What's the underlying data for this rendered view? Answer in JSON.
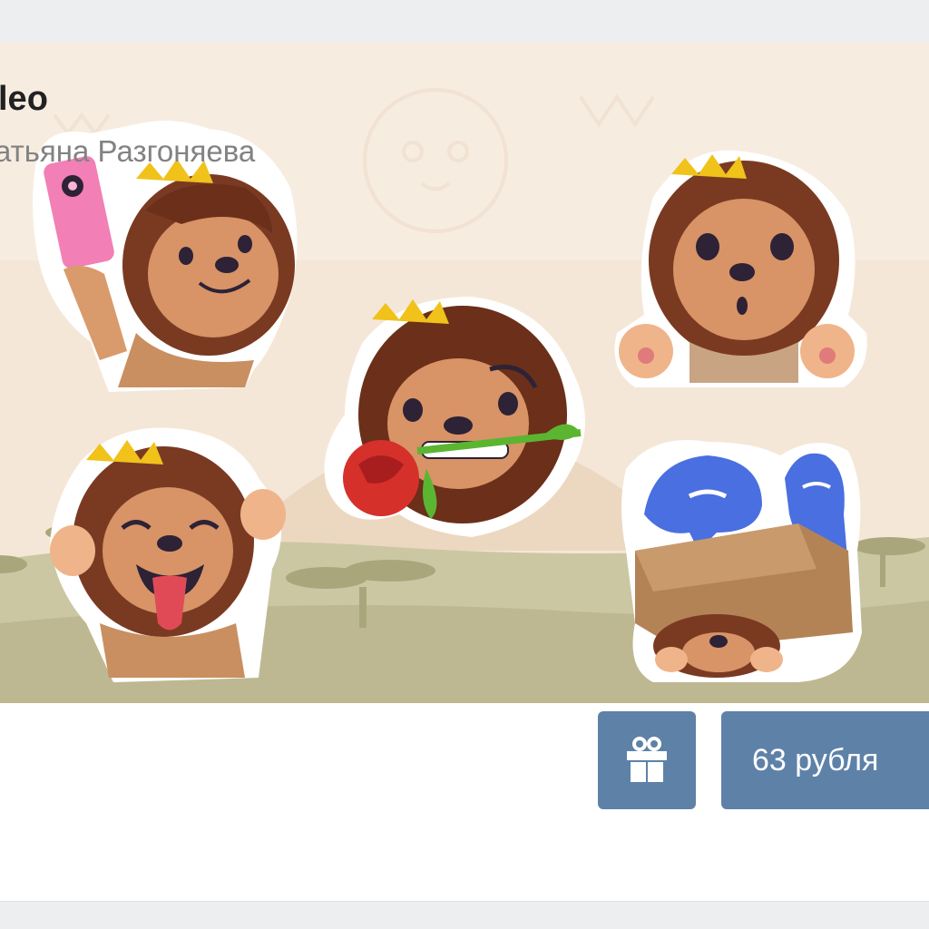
{
  "sticker_pack": {
    "title": "leo",
    "author": "атьяна Разгоняева",
    "price_label": "63 рубля",
    "icons": {
      "gift": "gift-icon"
    },
    "stickers": [
      "lion-selfie-sticker",
      "lion-surprised-sticker",
      "lion-rose-sticker",
      "lion-tongue-sticker",
      "lion-box-ghosts-sticker"
    ]
  },
  "colors": {
    "page_background": "#edeef0",
    "banner_background": "#f5e7d7",
    "button": "#5e81a8",
    "button_text": "#ffffff",
    "title_text": "#222222",
    "author_text": "#828282"
  }
}
